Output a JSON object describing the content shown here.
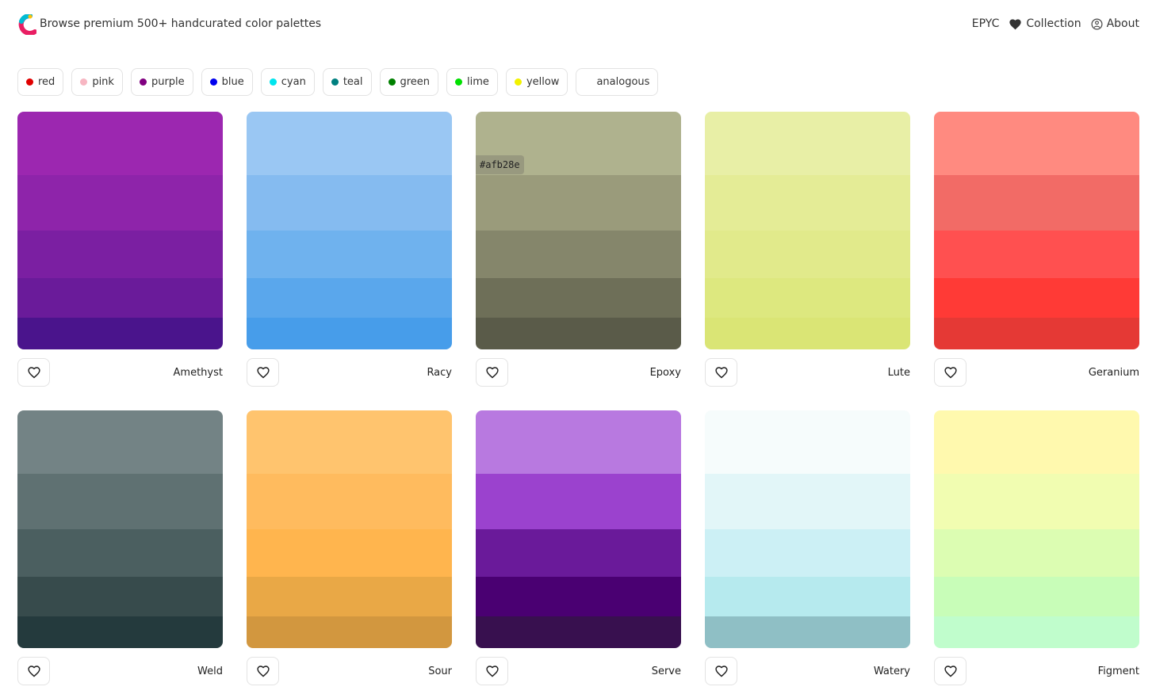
{
  "header": {
    "tagline": "Browse premium 500+ handcurated color palettes",
    "nav": [
      {
        "label": "EPYC",
        "icon": ""
      },
      {
        "label": "Collection",
        "icon": "heart-icon"
      },
      {
        "label": "About",
        "icon": "info-icon"
      }
    ],
    "logo_colors": [
      "#e91e63",
      "#00bcd4",
      "#ffc107"
    ]
  },
  "filters": [
    {
      "label": "red",
      "color": "#e00000"
    },
    {
      "label": "pink",
      "color": "#f7b6c2"
    },
    {
      "label": "purple",
      "color": "#800080"
    },
    {
      "label": "blue",
      "color": "#0000ee"
    },
    {
      "label": "cyan",
      "color": "#00e5ee"
    },
    {
      "label": "teal",
      "color": "#008080"
    },
    {
      "label": "green",
      "color": "#008000"
    },
    {
      "label": "lime",
      "color": "#00e000"
    },
    {
      "label": "yellow",
      "color": "#f2f200"
    },
    {
      "label": "analogous",
      "color": ""
    }
  ],
  "palettes": [
    {
      "name": "Amethyst",
      "colors": [
        "#9c27b0",
        "#8e24aa",
        "#7b1fa2",
        "#6a1b9a",
        "#4a148c"
      ]
    },
    {
      "name": "Racy",
      "colors": [
        "#9ac7f3",
        "#85bbf0",
        "#6fb2ee",
        "#5aa7ec",
        "#479dea"
      ]
    },
    {
      "name": "Epoxy",
      "colors": [
        "#afb28e",
        "#9a9b7b",
        "#85866b",
        "#6e6f58",
        "#5a5b49"
      ],
      "hover_hex": "#afb28e"
    },
    {
      "name": "Lute",
      "colors": [
        "#e8efa6",
        "#e4ec96",
        "#e1ea8b",
        "#dde87f",
        "#dae575"
      ]
    },
    {
      "name": "Geranium",
      "colors": [
        "#ff8a80",
        "#f26b66",
        "#ff5050",
        "#ff3a36",
        "#e53935"
      ]
    },
    {
      "name": "Weld",
      "colors": [
        "#738385",
        "#5f7172",
        "#4b5f60",
        "#374b4c",
        "#243a3d"
      ]
    },
    {
      "name": "Sour",
      "colors": [
        "#ffc46e",
        "#ffbb5e",
        "#ffb54e",
        "#e9a846",
        "#d2973f"
      ]
    },
    {
      "name": "Serve",
      "colors": [
        "#b879e0",
        "#9b42ce",
        "#6a1a9a",
        "#4a0072",
        "#38104f"
      ]
    },
    {
      "name": "Watery",
      "colors": [
        "#f6fcfc",
        "#e2f6f8",
        "#ccf0f5",
        "#b6eaee",
        "#8fbfc5"
      ]
    },
    {
      "name": "Figment",
      "colors": [
        "#fff9ae",
        "#f1fdb1",
        "#dcfdb2",
        "#c8fdb8",
        "#c0fdcc"
      ]
    }
  ]
}
